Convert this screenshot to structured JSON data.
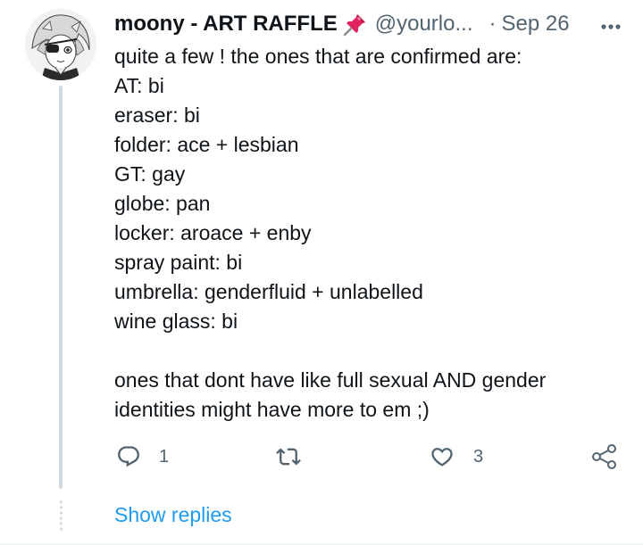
{
  "tweet": {
    "author": {
      "display_name": "moony - ART RAFFLE",
      "name_emoji": "pushpin",
      "handle": "@yourlo...",
      "avatar": "anime-character-avatar"
    },
    "separator": "·",
    "date": "Sep 26",
    "more_icon": "more-horizontal-icon",
    "body_lines": [
      "quite a few ! the ones that are confirmed are:",
      "AT: bi",
      "eraser: bi",
      "folder: ace + lesbian",
      "GT: gay",
      "globe: pan",
      "locker: aroace + enby",
      "spray paint: bi",
      "umbrella: genderfluid + unlabelled",
      "wine glass: bi",
      "",
      "ones that dont have like full sexual AND gender",
      "identities might have more to em ;)"
    ],
    "actions": {
      "reply": {
        "icon": "reply-icon",
        "count": "1"
      },
      "retweet": {
        "icon": "retweet-icon",
        "count": ""
      },
      "like": {
        "icon": "heart-icon",
        "count": "3"
      },
      "share": {
        "icon": "share-icon"
      }
    }
  },
  "show_replies_label": "Show replies",
  "colors": {
    "text_primary": "#0f1419",
    "text_secondary": "#536471",
    "accent": "#1d9bf0",
    "thread_line": "#cfd9de",
    "pin_red": "#e0245e"
  }
}
